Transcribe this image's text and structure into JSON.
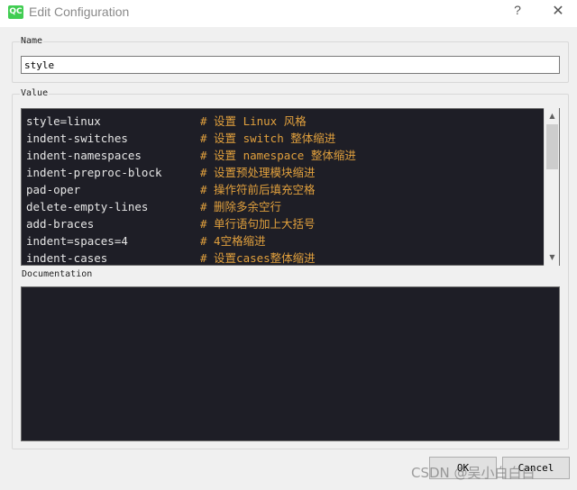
{
  "window": {
    "app_icon_text": "QC",
    "title": "Edit Configuration",
    "help_glyph": "?",
    "close_glyph": "✕"
  },
  "name_group": {
    "label": "Name",
    "value": "style"
  },
  "value_group": {
    "label": "Value",
    "lines": [
      {
        "option": "style=linux",
        "comment": "# 设置 Linux 风格"
      },
      {
        "option": "indent-switches",
        "comment": "# 设置 switch 整体缩进"
      },
      {
        "option": "indent-namespaces",
        "comment": "# 设置 namespace 整体缩进"
      },
      {
        "option": "indent-preproc-block",
        "comment": "# 设置预处理模块缩进"
      },
      {
        "option": "pad-oper",
        "comment": "# 操作符前后填充空格"
      },
      {
        "option": "delete-empty-lines",
        "comment": "# 删除多余空行"
      },
      {
        "option": "add-braces",
        "comment": "# 单行语句加上大括号"
      },
      {
        "option": "indent=spaces=4",
        "comment": "# 4空格缩进"
      },
      {
        "option": "indent-cases",
        "comment": "# 设置cases整体缩进"
      }
    ],
    "scroll_up_glyph": "▲",
    "scroll_down_glyph": "▼"
  },
  "documentation": {
    "label": "Documentation",
    "text": ""
  },
  "buttons": {
    "ok": "OK",
    "cancel": "Cancel"
  },
  "watermark": "CSDN @吴小白白白"
}
